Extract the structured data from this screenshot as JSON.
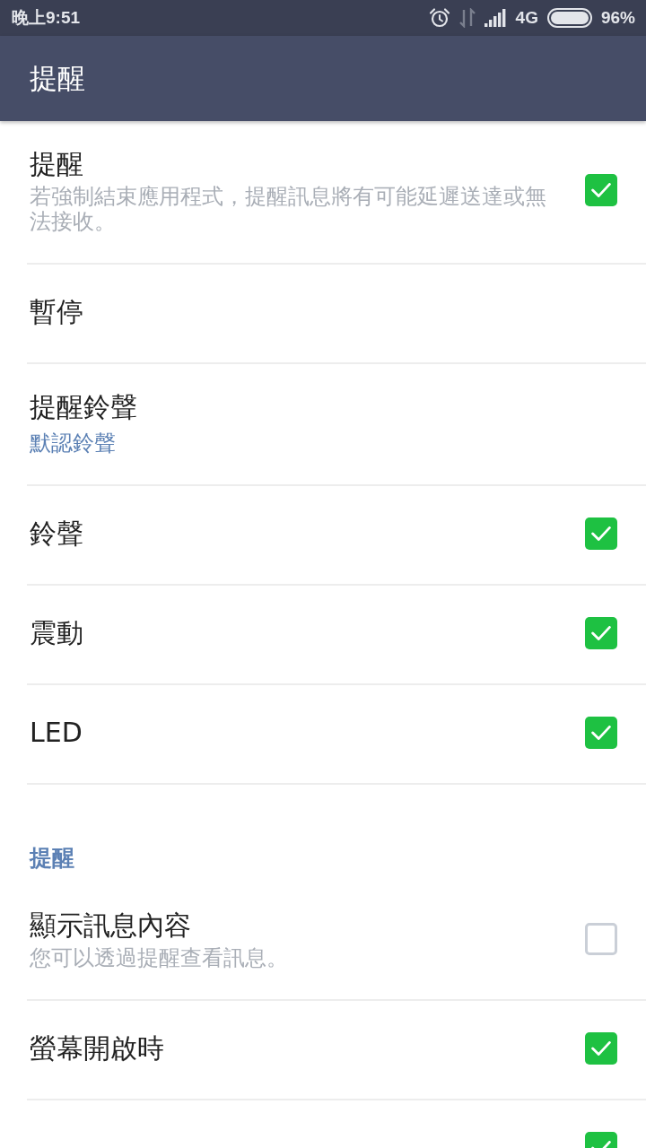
{
  "status_bar": {
    "time": "晚上9:51",
    "network": "4G",
    "battery": "96%"
  },
  "app_bar": {
    "title": "提醒"
  },
  "groups": [
    {
      "items": [
        {
          "kind": "checkbox",
          "title": "提醒",
          "subtitle": "若強制結束應用程式，提醒訊息將有可能延遲送達或無法接收。",
          "checked": true
        },
        {
          "kind": "link",
          "title": "暫停"
        },
        {
          "kind": "picker",
          "title": "提醒鈴聲",
          "value": "默認鈴聲"
        },
        {
          "kind": "checkbox",
          "title": "鈴聲",
          "checked": true
        },
        {
          "kind": "checkbox",
          "title": "震動",
          "checked": true
        },
        {
          "kind": "checkbox",
          "title": "LED",
          "checked": true
        }
      ]
    },
    {
      "header": "提醒",
      "items": [
        {
          "kind": "checkbox",
          "title": "顯示訊息內容",
          "subtitle": "您可以透過提醒查看訊息。",
          "checked": false
        },
        {
          "kind": "checkbox",
          "title": "螢幕開啟時",
          "checked": true
        },
        {
          "kind": "checkbox",
          "checked": true
        }
      ]
    }
  ]
}
